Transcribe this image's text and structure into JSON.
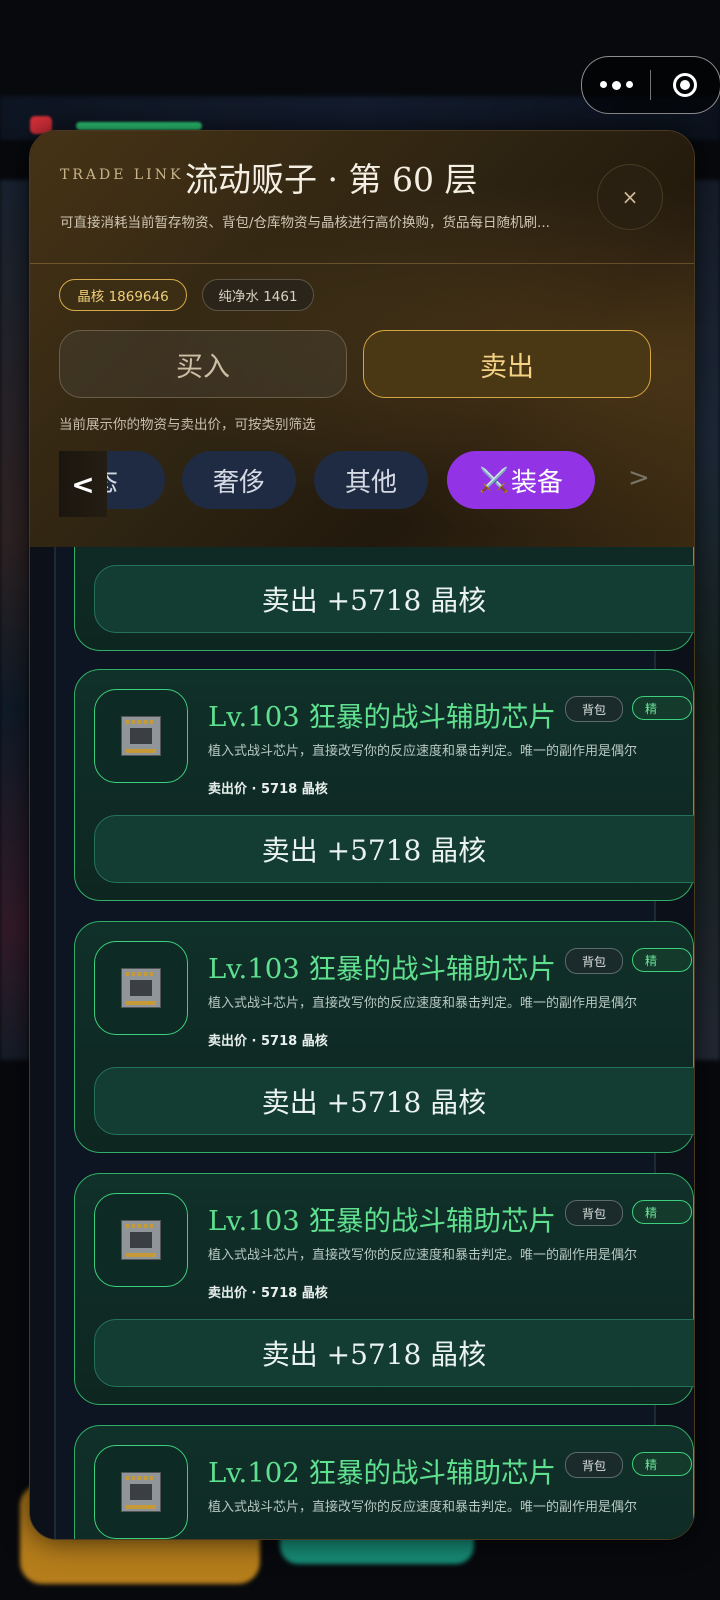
{
  "capsule": {
    "menu_icon": "more-dots-icon",
    "close_icon": "record-target-icon"
  },
  "header": {
    "eyebrow": "TRADE LINK",
    "title": "流动贩子 · 第 60 层",
    "subtitle": "可直接消耗当前暂存物资、背包/仓库物资与晶核进行高价换购，货品每日随机刷...",
    "close_label": "×"
  },
  "balances": {
    "core": "晶核 1869646",
    "water": "纯净水 1461"
  },
  "modes": {
    "buy": "买入",
    "sell": "卖出",
    "active": "sell"
  },
  "hint": "当前展示你的物资与卖出价，可按类别筛选",
  "categories": {
    "left_arrow": "<",
    "right_arrow": ">",
    "items": [
      "生态",
      "奢侈",
      "其他",
      "装备"
    ],
    "active_icon": "⚔️",
    "active": "装备",
    "active_color": "#9333e6"
  },
  "items": [
    {
      "name": "",
      "bag_tag": "",
      "tag2": "",
      "desc": "",
      "price": "",
      "sell_label": "卖出 +5718 晶核"
    },
    {
      "name": "Lv.103 狂暴的战斗辅助芯片",
      "bag_tag": "背包",
      "tag2": "精",
      "desc": "植入式战斗芯片，直接改写你的反应速度和暴击判定。唯一的副作用是偶尔",
      "price": "卖出价 · 5718 晶核",
      "sell_label": "卖出 +5718 晶核"
    },
    {
      "name": "Lv.103 狂暴的战斗辅助芯片",
      "bag_tag": "背包",
      "tag2": "精",
      "desc": "植入式战斗芯片，直接改写你的反应速度和暴击判定。唯一的副作用是偶尔",
      "price": "卖出价 · 5718 晶核",
      "sell_label": "卖出 +5718 晶核"
    },
    {
      "name": "Lv.103 狂暴的战斗辅助芯片",
      "bag_tag": "背包",
      "tag2": "精",
      "desc": "植入式战斗芯片，直接改写你的反应速度和暴击判定。唯一的副作用是偶尔",
      "price": "卖出价 · 5718 晶核",
      "sell_label": "卖出 +5718 晶核"
    },
    {
      "name": "Lv.102 狂暴的战斗辅助芯片",
      "bag_tag": "背包",
      "tag2": "精",
      "desc": "植入式战斗芯片，直接改写你的反应速度和暴击判定。唯一的副作用是偶尔",
      "price": "",
      "sell_label": ""
    }
  ],
  "colors": {
    "accent_gold": "#d6a544",
    "item_green": "#5fe08f",
    "card_border": "#2fae67"
  }
}
